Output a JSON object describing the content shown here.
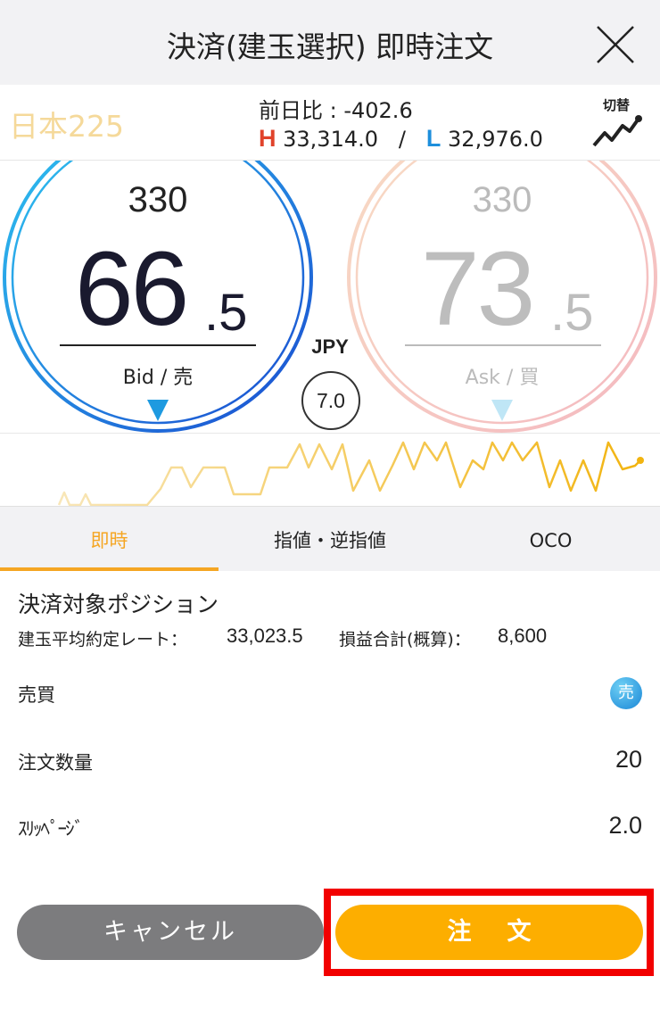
{
  "header": {
    "title": "決済(建玉選択) 即時注文",
    "close_icon": "close-icon"
  },
  "instrument": {
    "name": "日本225",
    "change_label": "前日比 : -402.6",
    "high_label": "H",
    "high_value": "33,314.0",
    "separator": "/",
    "low_label": "L",
    "low_value": "32,976.0",
    "switch_label": "切替",
    "switch_icon": "line-chart-icon"
  },
  "bid": {
    "qty": "330",
    "price_main": "66",
    "price_sub": ".5",
    "label": "Bid / 売",
    "color": "#1e8fdc"
  },
  "ask": {
    "qty": "330",
    "price_main": "73",
    "price_sub": ".5",
    "label": "Ask / 買",
    "color": "#f4c8c8"
  },
  "spread": {
    "currency": "JPY",
    "value": "7.0"
  },
  "tick_chart": {
    "color": "#f5c242"
  },
  "tabs": [
    {
      "label": "即時",
      "active": true
    },
    {
      "label": "指値・逆指値",
      "active": false
    },
    {
      "label": "OCO",
      "active": false
    }
  ],
  "position": {
    "title": "決済対象ポジション",
    "avg_rate_label": "建玉平均約定レート：",
    "avg_rate_value": "33,023.5",
    "pnl_label": "損益合計(概算)：",
    "pnl_value": "8,600"
  },
  "form": {
    "side_label": "売買",
    "side_badge": "売",
    "qty_label": "注文数量",
    "qty_value": "20",
    "slippage_label": "ｽﾘｯﾍﾟｰｼﾞ",
    "slippage_value": "2.0"
  },
  "buttons": {
    "cancel": "キャンセル",
    "order": "注文"
  },
  "accent_colors": {
    "orange": "#fdae00",
    "highlight_red": "#f20000"
  }
}
